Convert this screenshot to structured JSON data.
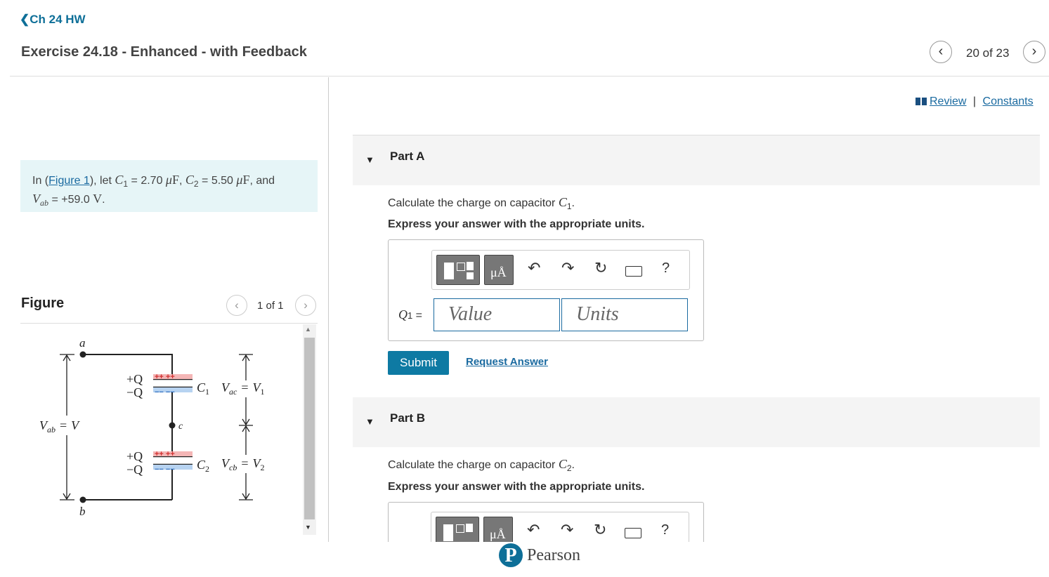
{
  "header": {
    "back_label": "Ch 24 HW",
    "title": "Exercise 24.18 - Enhanced - with Feedback",
    "pager": "20 of 23"
  },
  "links": {
    "review": "Review",
    "sep": "|",
    "constants": "Constants"
  },
  "problem": {
    "prefix": "In (",
    "figure_link": "Figure 1",
    "text1": "), let ",
    "c1_sym": "C",
    "c1_sub": "1",
    "eq1": " = 2.70 ",
    "unit_mu": "μ",
    "unit_f": "F",
    "comma": ", ",
    "c2_sym": "C",
    "c2_sub": "2",
    "eq2": " = 5.50 ",
    "and": ", and",
    "v_sym": "V",
    "v_sub": "ab",
    "eq3": " = +59.0 ",
    "unit_v": "V",
    "end": "."
  },
  "figure": {
    "label": "Figure",
    "pager": "1 of 1",
    "node_a": "a",
    "node_b": "b",
    "node_c": "c",
    "plusQ": "+Q",
    "minusQ": "−Q",
    "plus_signs": "++ ++",
    "minus_signs": "−− −−",
    "c1": "C",
    "c1_sub": "1",
    "c2": "C",
    "c2_sub": "2",
    "vac": "V",
    "vac_sub": "ac",
    "eq": "=",
    "v1": "V",
    "v1_sub": "1",
    "vcb": "V",
    "vcb_sub": "cb",
    "v2": "V",
    "v2_sub": "2",
    "vab": "V",
    "vab_sub": "ab",
    "v": "V"
  },
  "partA": {
    "label": "Part A",
    "question_prefix": "Calculate the charge on capacitor ",
    "cap_sym": "C",
    "cap_sub": "1",
    "dot": ".",
    "instruction": "Express your answer with the appropriate units.",
    "q_sym": "Q",
    "q_sub": "1",
    "eq": " =",
    "value_placeholder": "Value",
    "units_placeholder": "Units",
    "submit": "Submit",
    "request": "Request Answer"
  },
  "partB": {
    "label": "Part B",
    "question_prefix": "Calculate the charge on capacitor ",
    "cap_sym": "C",
    "cap_sub": "2",
    "dot": ".",
    "instruction": "Express your answer with the appropriate units."
  },
  "toolbar": {
    "units_btn": "μÅ",
    "help": "?"
  },
  "footer": {
    "brand": "Pearson",
    "logo_letter": "P"
  }
}
